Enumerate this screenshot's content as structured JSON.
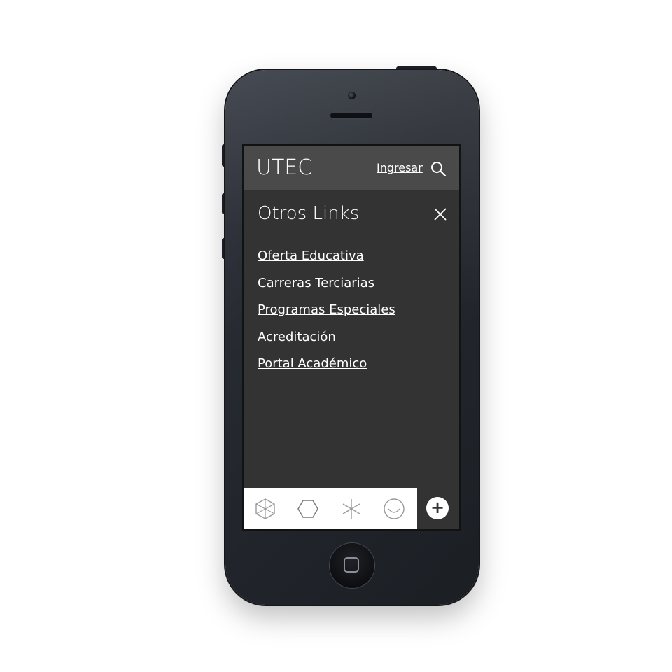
{
  "header": {
    "logo_text": "UTEC",
    "login_label": "Ingresar",
    "search_icon": "search-icon"
  },
  "menu": {
    "title": "Otros Links",
    "close_icon": "close-icon",
    "links": [
      {
        "label": "Oferta Educativa"
      },
      {
        "label": "Carreras Terciarias"
      },
      {
        "label": "Programas Especiales"
      },
      {
        "label": "Acreditación"
      },
      {
        "label": "Portal Académico"
      }
    ]
  },
  "bottom_bar": {
    "icons": [
      "cube-icon",
      "hexagon-icon",
      "asterisk-icon",
      "smiley-icon"
    ],
    "plus_label": "+"
  },
  "colors": {
    "screen_bg": "#333333",
    "header_bg": "#4a4a4a",
    "text": "#ffffff",
    "icon_gray": "#9a9a9a"
  }
}
